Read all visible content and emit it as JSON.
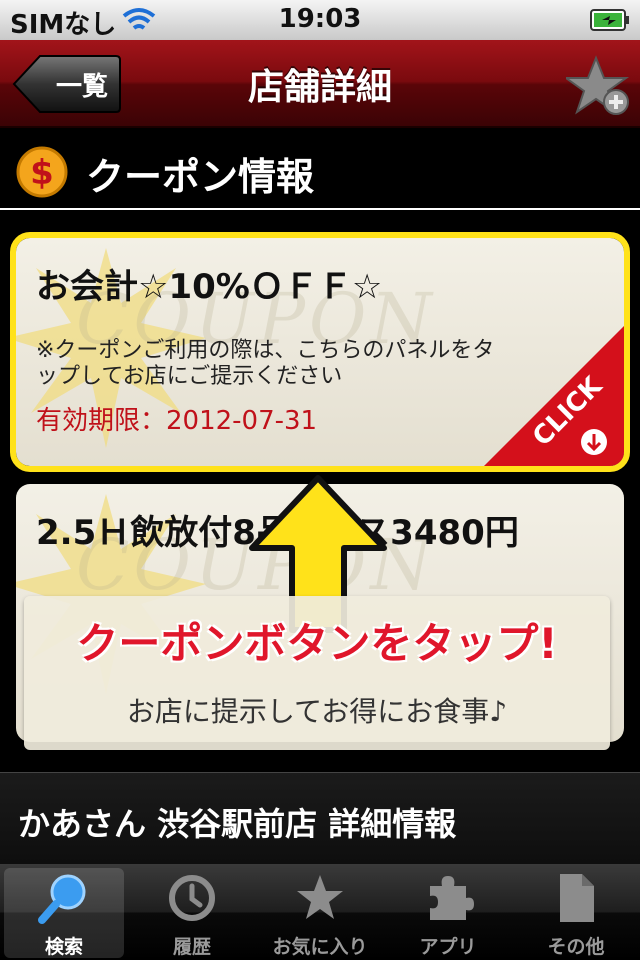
{
  "status": {
    "carrier": "SIMなし",
    "time": "19:03"
  },
  "nav": {
    "back_label": "一覧",
    "title": "店舗詳細"
  },
  "section": {
    "title": "クーポン情報"
  },
  "coupons": [
    {
      "title": "お会計☆10%ＯＦＦ☆",
      "note": "※クーポンご利用の際は、こちらのパネルをタップしてお店にご提示ください",
      "expiry": "有効期限：2012-07-31",
      "click_label": "CLICK",
      "watermark": "COUPON"
    },
    {
      "title": "2.5Ｈ飲放付8品コース3480円",
      "watermark": "COUPON"
    }
  ],
  "callout": {
    "main": "クーポンボタンをタップ!",
    "sub": "お店に提示してお得にお食事♪"
  },
  "detail": {
    "label": "かあさん 渋谷駅前店 詳細情報"
  },
  "tabs": [
    {
      "label": "検索",
      "icon": "search-icon"
    },
    {
      "label": "履歴",
      "icon": "history-icon"
    },
    {
      "label": "お気に入り",
      "icon": "star-icon"
    },
    {
      "label": "アプリ",
      "icon": "puzzle-icon"
    },
    {
      "label": "その他",
      "icon": "document-icon"
    }
  ],
  "colors": {
    "nav": "#7a0a0e",
    "highlight": "#ffe21a",
    "callout_text": "#e0162b",
    "expiry": "#c0111a"
  }
}
